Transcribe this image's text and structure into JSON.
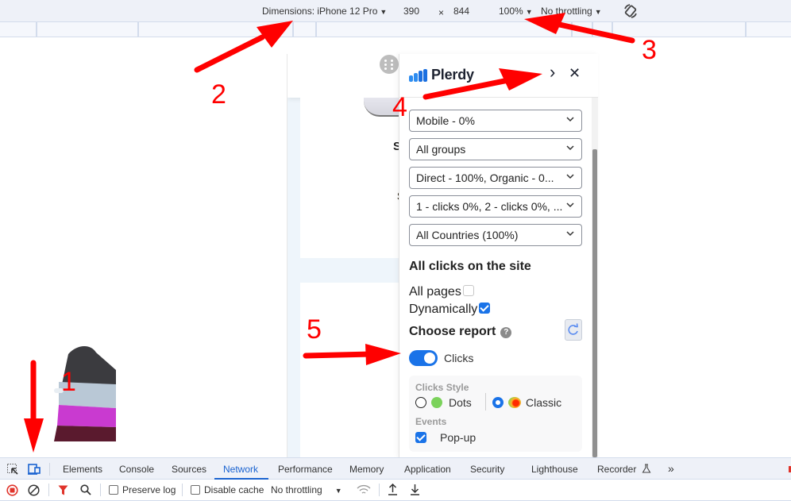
{
  "device_toolbar": {
    "dimensions_label": "Dimensions: iPhone 12 Pro",
    "width": "390",
    "times": "×",
    "height": "844",
    "zoom": "100%",
    "throttling": "No throttling"
  },
  "page": {
    "letters": [
      "S",
      "S"
    ]
  },
  "plerdy": {
    "logo_text": "Plerdy",
    "expand_glyph": "›",
    "close_glyph": "✕",
    "selects": [
      {
        "value": "Mobile - 0%"
      },
      {
        "value": "All groups"
      },
      {
        "value": "Direct - 100%, Organic - 0..."
      },
      {
        "value": "1 - clicks 0%, 2 - clicks 0%, ..."
      },
      {
        "value": "All Countries (100%)"
      }
    ],
    "section_title": "All clicks on the site",
    "all_pages_label": "All pages",
    "all_pages_checked": false,
    "dynamically_label": "Dynamically",
    "dynamically_checked": true,
    "choose_report_label": "Choose report",
    "help_glyph": "?",
    "clicks_toggle_label": "Clicks",
    "clicks_toggle_on": true,
    "clicks_style_title": "Clicks Style",
    "style_options": [
      {
        "label": "Dots",
        "selected": false
      },
      {
        "label": "Classic",
        "selected": true
      }
    ],
    "events_title": "Events",
    "popup_label": "Pop-up",
    "popup_checked": true
  },
  "annotations": [
    "1",
    "2",
    "3",
    "4",
    "5"
  ],
  "devtools": {
    "tabs": [
      "Elements",
      "Console",
      "Sources",
      "Network",
      "Performance",
      "Memory",
      "Application",
      "Security",
      "Lighthouse",
      "Recorder"
    ],
    "active_tab": "Network",
    "more_glyph": "»",
    "toolbar": {
      "preserve_log": "Preserve log",
      "disable_cache": "Disable cache",
      "throttling": "No throttling"
    }
  },
  "colors": {
    "accent": "#1a73e8",
    "annotation": "#ff0000",
    "devtools_active": "#1a63d0"
  }
}
